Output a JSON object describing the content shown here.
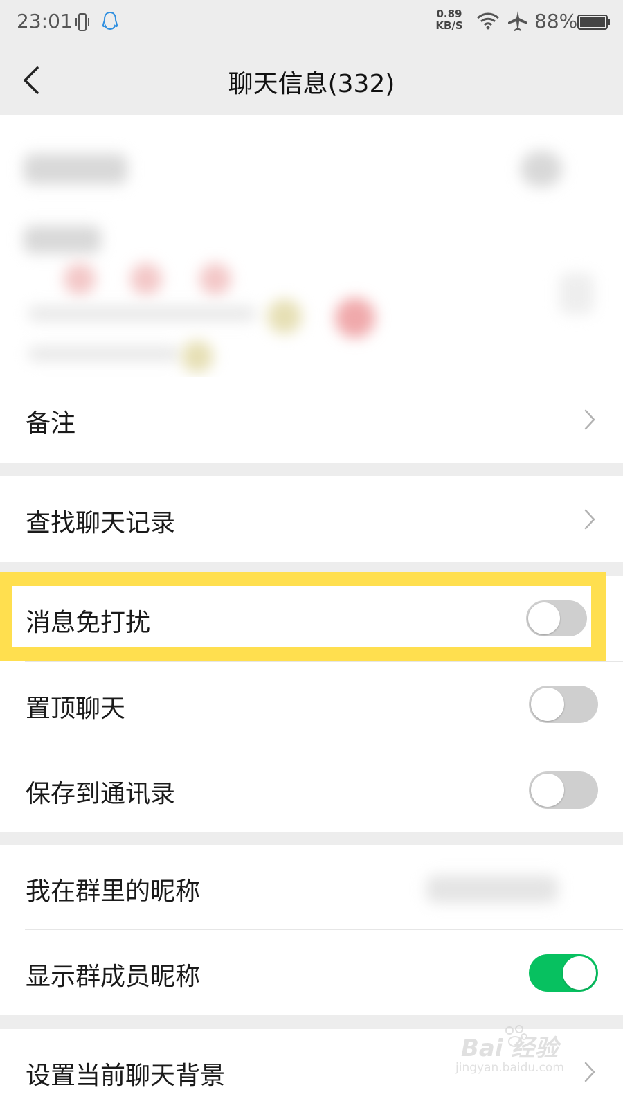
{
  "status_bar": {
    "time": "23:01",
    "net_speed_value": "0.89",
    "net_speed_unit": "KB/S",
    "battery_percent": "88%"
  },
  "nav": {
    "title": "聊天信息(332)"
  },
  "rows": {
    "remark": {
      "label": "备注"
    },
    "search_history": {
      "label": "查找聊天记录"
    },
    "do_not_disturb": {
      "label": "消息免打扰",
      "toggle_on": false
    },
    "sticky_on_top": {
      "label": "置顶聊天",
      "toggle_on": false
    },
    "save_to_contacts": {
      "label": "保存到通讯录",
      "toggle_on": false
    },
    "my_group_nickname": {
      "label": "我在群里的昵称"
    },
    "show_member_nicknames": {
      "label": "显示群成员昵称",
      "toggle_on": true
    },
    "chat_background": {
      "label": "设置当前聊天背景"
    }
  },
  "colors": {
    "toggle_on": "#07c160",
    "toggle_off": "#cfcfcf",
    "highlight": "#ffdf4f"
  },
  "watermark": {
    "brand": "Bai 经验",
    "url": "jingyan.baidu.com"
  }
}
